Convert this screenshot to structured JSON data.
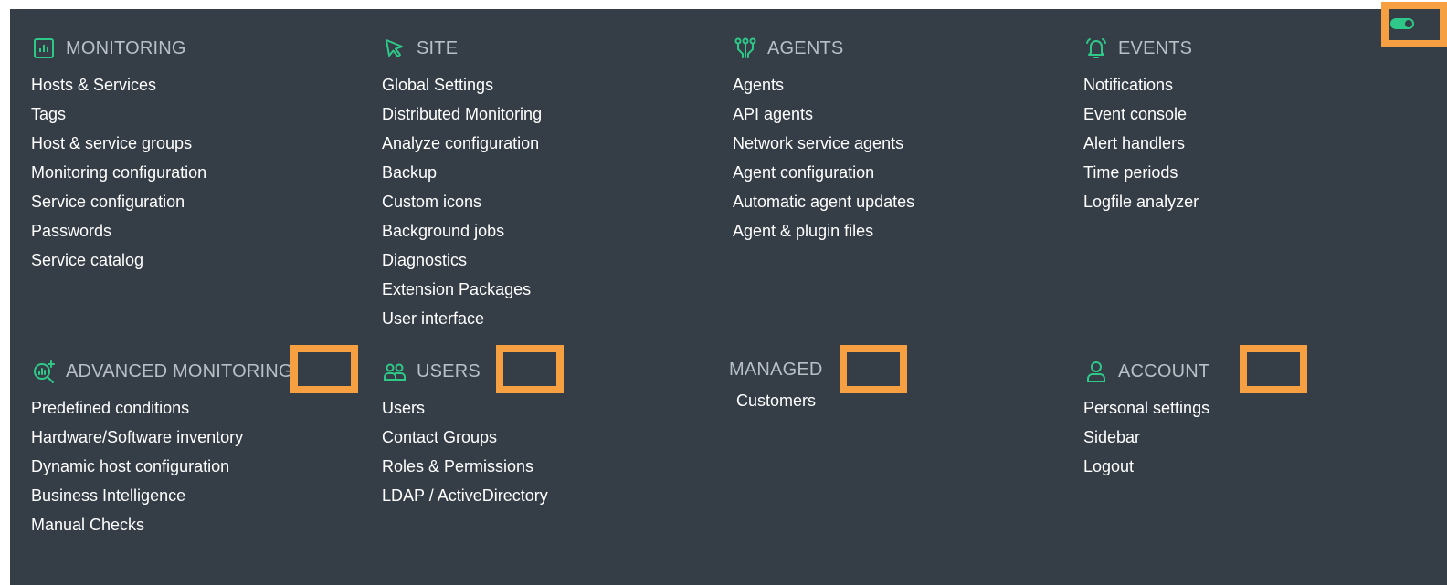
{
  "colors": {
    "panel_bg": "#353d46",
    "header_text": "#b8bfc7",
    "item_text": "#ffffff",
    "icon_green": "#2ec989",
    "highlight_orange": "#f7a042"
  },
  "sections": {
    "monitoring": {
      "title": "MONITORING",
      "icon": "chart-box-icon",
      "items": [
        "Hosts & Services",
        "Tags",
        "Host & service groups",
        "Monitoring configuration",
        "Service configuration",
        "Passwords",
        "Service catalog"
      ]
    },
    "site": {
      "title": "SITE",
      "icon": "cursor-pointer-icon",
      "items": [
        "Global Settings",
        "Distributed Monitoring",
        "Analyze configuration",
        "Backup",
        "Custom icons",
        "Background jobs",
        "Diagnostics",
        "Extension Packages",
        "User interface"
      ]
    },
    "agents": {
      "title": "AGENTS",
      "icon": "agents-network-icon",
      "items": [
        "Agents",
        "API agents",
        "Network service agents",
        "Agent configuration",
        "Automatic agent updates",
        "Agent & plugin files"
      ]
    },
    "events": {
      "title": "EVENTS",
      "icon": "bell-icon",
      "items": [
        "Notifications",
        "Event console",
        "Alert handlers",
        "Time periods",
        "Logfile analyzer"
      ]
    },
    "advanced_monitoring": {
      "title": "ADVANCED MONITORING",
      "icon": "magnifier-chart-icon",
      "items": [
        "Predefined conditions",
        "Hardware/Software inventory",
        "Dynamic host configuration",
        "Business Intelligence",
        "Manual Checks"
      ]
    },
    "users": {
      "title": "USERS",
      "icon": "users-group-icon",
      "items": [
        "Users",
        "Contact Groups",
        "Roles & Permissions",
        "LDAP / ActiveDirectory"
      ]
    },
    "managed": {
      "title": "MANAGED",
      "items": [
        "Customers"
      ]
    },
    "account": {
      "title": "ACCOUNT",
      "icon": "user-icon",
      "items": [
        "Personal settings",
        "Sidebar",
        "Logout"
      ]
    }
  },
  "toggle": {
    "icon": "toggle-switch-icon",
    "state": "on"
  }
}
